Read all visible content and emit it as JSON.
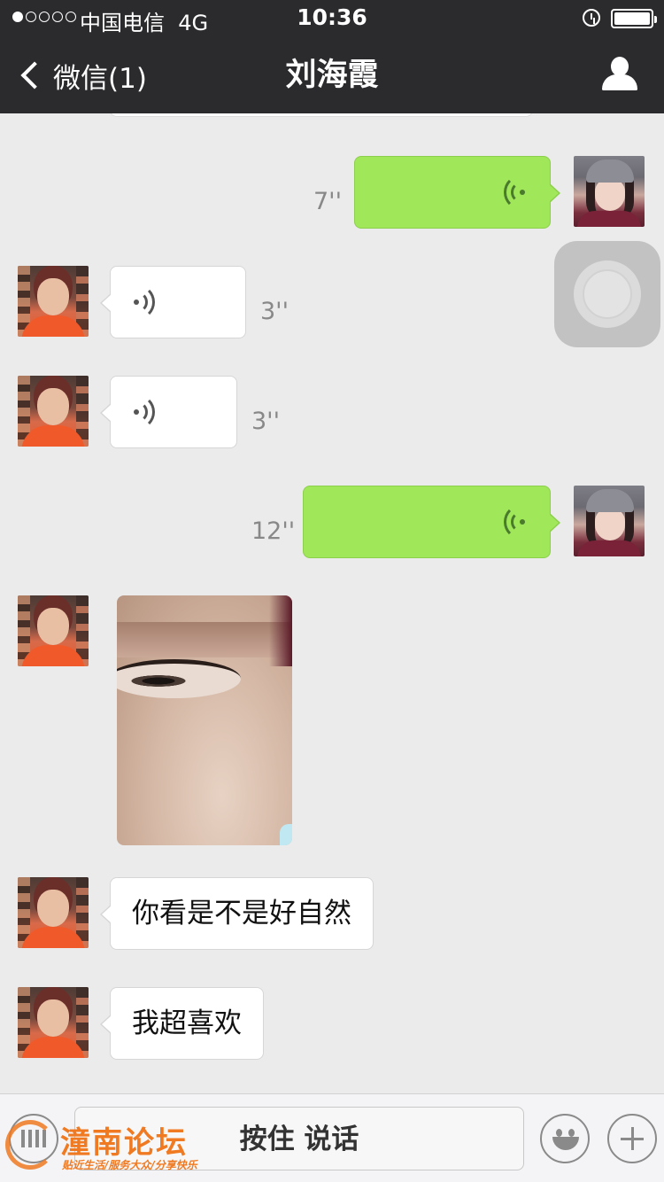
{
  "status_bar": {
    "carrier": "中国电信",
    "network": "4G",
    "time": "10:36"
  },
  "nav": {
    "back_label": "微信(1)",
    "title": "刘海霞"
  },
  "messages": [
    {
      "side": "right",
      "type": "voice",
      "duration": "7''"
    },
    {
      "side": "left",
      "type": "voice",
      "duration": "3''"
    },
    {
      "side": "left",
      "type": "voice",
      "duration": "3''"
    },
    {
      "side": "right",
      "type": "voice",
      "duration": "12''"
    },
    {
      "side": "left",
      "type": "image"
    },
    {
      "side": "left",
      "type": "text",
      "text": "你看是不是好自然"
    },
    {
      "side": "left",
      "type": "text",
      "text": "我超喜欢"
    }
  ],
  "toolbar": {
    "hold_to_talk": "按住 说话"
  },
  "watermark": {
    "name": "潼南论坛",
    "slogan": "贴近生活/服务大众/分享快乐"
  },
  "colors": {
    "nav_bg": "#2b2b2e",
    "chat_bg": "#ebebeb",
    "outgoing_bubble": "#a0e75a",
    "incoming_bubble": "#ffffff",
    "watermark": "#f07a22"
  },
  "icons": [
    "back-chevron-icon",
    "profile-icon",
    "voice-wave-icon",
    "keyboard-icon",
    "emoji-icon",
    "plus-icon",
    "alarm-icon",
    "battery-icon"
  ]
}
